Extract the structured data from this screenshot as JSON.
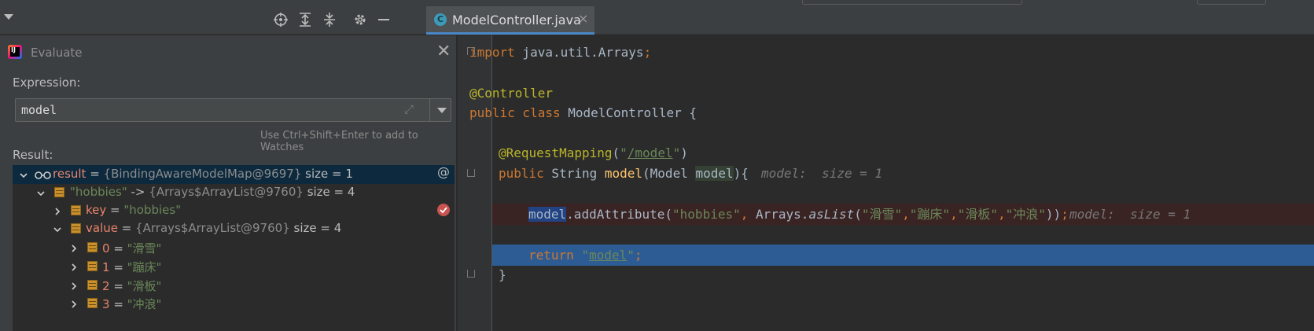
{
  "toolbar": {
    "icons": [
      "crosshair-icon",
      "expand-all-icon",
      "collapse-all-icon",
      "gear-icon",
      "minimize-icon"
    ]
  },
  "tab": {
    "icon_letter": "C",
    "label": "ModelController.java",
    "close": "×"
  },
  "evaluate": {
    "title": "Evaluate",
    "close": "✕",
    "expression_label": "Expression:",
    "expression_value": "model",
    "hint": "Use Ctrl+Shift+Enter to add to Watches",
    "result_label": "Result:",
    "tree": [
      {
        "name": "result",
        "eq": " = ",
        "value": "{BindingAwareModelMap@9697}",
        "extra": "  size = 1"
      },
      {
        "name": "\"hobbies\"",
        "eq": " -> ",
        "value": "{Arrays$ArrayList@9760}",
        "extra": "  size = 4"
      },
      {
        "name": "key",
        "eq": " = ",
        "value": "\"hobbies\""
      },
      {
        "name": "value",
        "eq": " = ",
        "value": "{Arrays$ArrayList@9760}",
        "extra": "  size = 4"
      },
      {
        "name": "0",
        "eq": " = ",
        "value": "\"滑雪\""
      },
      {
        "name": "1",
        "eq": " = ",
        "value": "\"蹦床\""
      },
      {
        "name": "2",
        "eq": " = ",
        "value": "\"滑板\""
      },
      {
        "name": "3",
        "eq": " = ",
        "value": "\"冲浪\""
      }
    ]
  },
  "code": {
    "l1_kw": "import",
    "l1_rest": " java.util.Arrays",
    "l1_semi": ";",
    "l2_ann": "@Controller",
    "l3_kw": "public class",
    "l3_rest": " ModelController {",
    "l4_ann": "@RequestMapping",
    "l4_open": "(",
    "l4_str1": "\"",
    "l4_path": "/model",
    "l4_str2": "\"",
    "l4_close": ")",
    "l5_kw": "public",
    "l5_type": " String ",
    "l5_fn": "model",
    "l5_args1": "(Model ",
    "l5_param": "model",
    "l5_args2": "){",
    "l5_hint": "model:  size = 1",
    "l6_var": "model",
    "l6_call": ".addAttribute(",
    "l6_s1": "\"hobbies\"",
    "l6_comma": ", ",
    "l6_cls": "Arrays.",
    "l6_fn": "asList",
    "l6_open": "(",
    "l6_a": "\"滑雪\"",
    "l6_b": "\"蹦床\"",
    "l6_c": "\"滑板\"",
    "l6_d": "\"冲浪\"",
    "l6_c1": ",",
    "l6_end": "))",
    "l6_semi": ";",
    "l6_hint": "model:  size = 1",
    "l7_kw": "return ",
    "l7_q1": "\"",
    "l7_str": "model",
    "l7_q2": "\"",
    "l7_semi": ";",
    "l8": "}"
  },
  "gutter": {
    "at_symbol": "@"
  },
  "colors": {
    "exec_line": "#2d5c94",
    "breakpoint": "#c75450",
    "selected_row": "#0d293e"
  }
}
